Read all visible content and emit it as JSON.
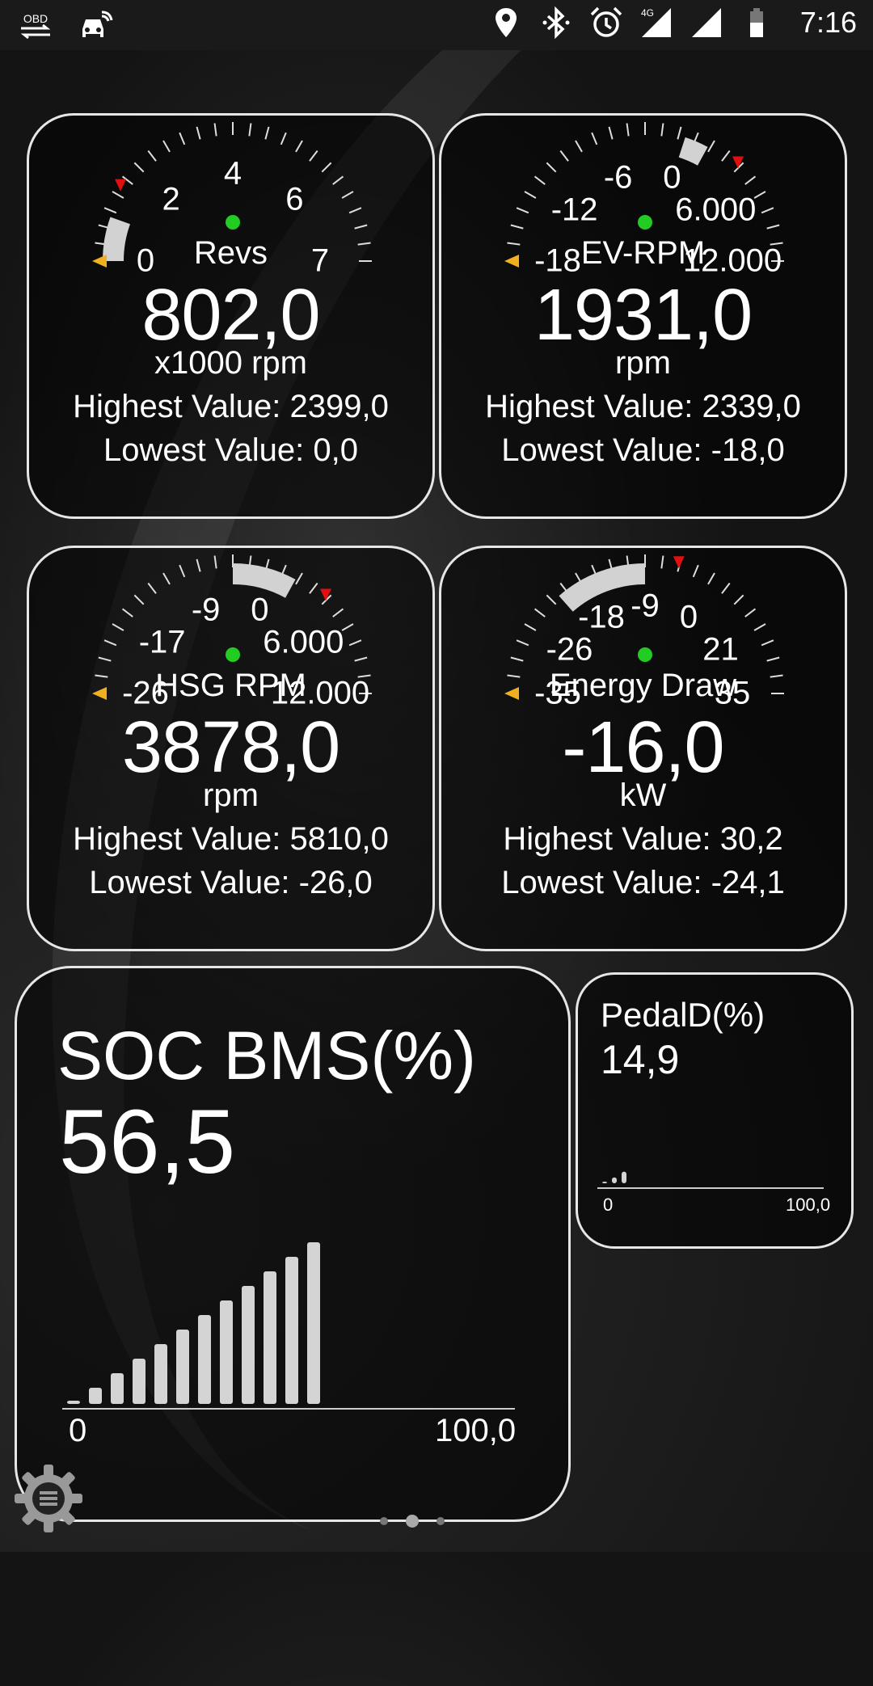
{
  "status_bar": {
    "left_icons": [
      "obd-icon",
      "car-icon"
    ],
    "right_icons": [
      "location-icon",
      "bluetooth-icon",
      "alarm-icon",
      "signal-4g-icon",
      "signal-icon",
      "battery-icon"
    ],
    "network_label": "4G",
    "obd_label": "OBD",
    "time": "7:16"
  },
  "gauges": [
    {
      "id": "revs",
      "name": "Revs",
      "value": "802,0",
      "unit": "x1000 rpm",
      "highest": "Highest Value: 2399,0",
      "lowest": "Lowest Value: 0,0",
      "tick_labels": [
        "0",
        "2",
        "4",
        "6",
        "7"
      ],
      "fill_from_fraction": 0.0,
      "fill_to_fraction": 0.11
    },
    {
      "id": "ev-rpm",
      "name": "EV-RPM",
      "value": "1931,0",
      "unit": "rpm",
      "highest": "Highest Value: 2339,0",
      "lowest": "Lowest Value: -18,0",
      "tick_labels": [
        "-18",
        "-12",
        "-6",
        "0",
        "6.000",
        "12.000"
      ],
      "fill_from_fraction": 0.6,
      "fill_to_fraction": 0.66
    },
    {
      "id": "hsg-rpm",
      "name": "HSG RPM",
      "value": "3878,0",
      "unit": "rpm",
      "highest": "Highest Value: 5810,0",
      "lowest": "Lowest Value: -26,0",
      "tick_labels": [
        "-26",
        "-17",
        "-9",
        "0",
        "6.000",
        "12.000"
      ],
      "fill_from_fraction": 0.5,
      "fill_to_fraction": 0.66
    },
    {
      "id": "energy-draw",
      "name": "Energy Draw",
      "value": "-16,0",
      "unit": "kW",
      "highest": "Highest Value: 30,2",
      "lowest": "Lowest Value: -24,1",
      "tick_labels": [
        "-35",
        "-26",
        "-18",
        "-9",
        "0",
        "21",
        "35"
      ],
      "fill_from_fraction": 0.27,
      "fill_to_fraction": 0.5
    }
  ],
  "soc": {
    "title": "SOC BMS(%)",
    "value": "56,5",
    "axis_min": "0",
    "axis_max": "100,0",
    "bar_levels": [
      2,
      10,
      19,
      28,
      37,
      46,
      55,
      64,
      73,
      82,
      91,
      100
    ]
  },
  "pedal": {
    "title": "PedalD(%)",
    "value": "14,9",
    "axis_min": "0",
    "axis_max": "100,0",
    "bar_levels": [
      10,
      45,
      90
    ]
  },
  "colors": {
    "fill_arc": "#d2d2d2",
    "center_dot": "#22cc22",
    "max_marker": "#e01010",
    "min_marker": "#f0b020",
    "card_border": "#e6e6e6"
  },
  "pager": {
    "pages": 3,
    "active": 2
  }
}
